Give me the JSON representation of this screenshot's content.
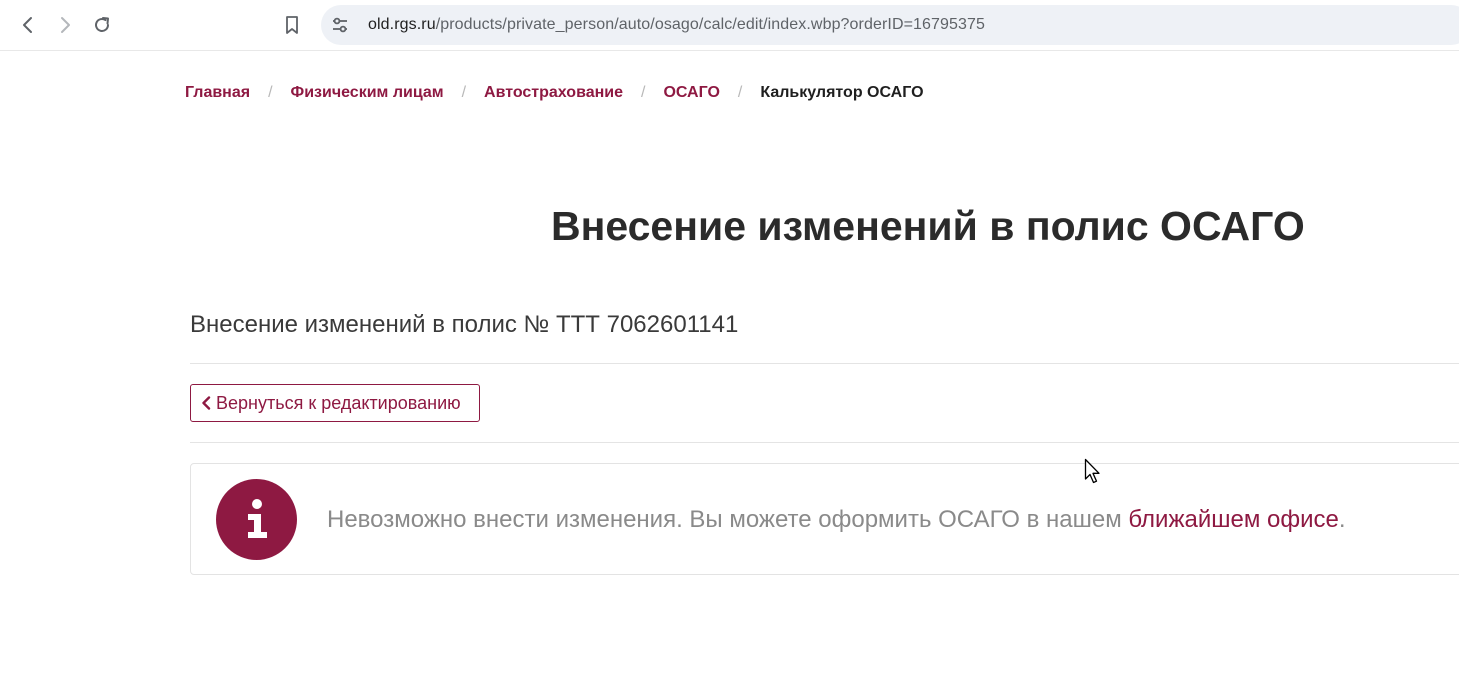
{
  "browser": {
    "url_host": "old.rgs.ru",
    "url_path": "/products/private_person/auto/osago/calc/edit/index.wbp?orderID=16795375"
  },
  "breadcrumb": {
    "items": [
      "Главная",
      "Физическим лицам",
      "Автострахование",
      "ОСАГО"
    ],
    "separator": "/",
    "current": "Калькулятор ОСАГО"
  },
  "page": {
    "title": "Внесение изменений в полис ОСАГО",
    "subtitle": "Внесение изменений в полис № ТТТ 7062601141",
    "back_button_label": "Вернуться к редактированию"
  },
  "notice": {
    "text": "Невозможно внести изменения. Вы можете оформить ОСАГО в нашем ",
    "link_text": "ближайшем офисе",
    "text_end": "."
  },
  "colors": {
    "brand": "#8e1942",
    "text_dark": "#2b2b2b",
    "text_muted": "#8a8a8a",
    "address_bar_bg": "#eef1f6"
  },
  "icons": {
    "back": "arrow-left-icon",
    "forward": "arrow-right-icon",
    "reload": "reload-icon",
    "bookmark": "bookmark-icon",
    "site_info": "tune-icon",
    "notice": "info-icon",
    "back_button": "chevron-left-icon"
  }
}
